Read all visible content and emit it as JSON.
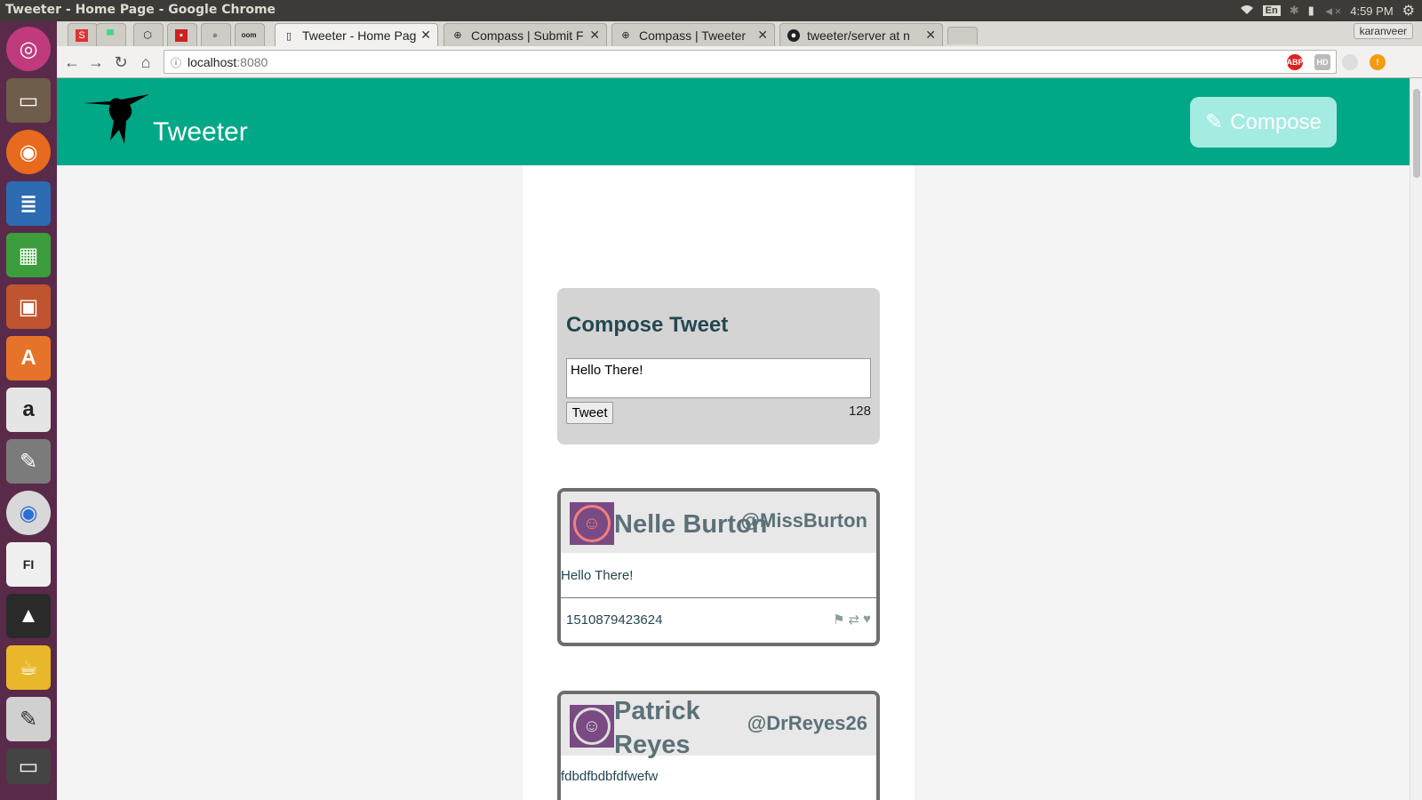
{
  "system": {
    "window_title": "Tweeter - Home Page - Google Chrome",
    "lang": "En",
    "time": "4:59 PM"
  },
  "browser": {
    "tabs": [
      {
        "label": "",
        "favicon": "S"
      },
      {
        "label": "",
        "favicon": "android-icon"
      },
      {
        "label": "",
        "favicon": "codepen-icon"
      },
      {
        "label": "",
        "favicon": "red-icon"
      },
      {
        "label": "",
        "favicon": "apple-icon"
      },
      {
        "label": "",
        "favicon": "oom"
      },
      {
        "label": "Tweeter - Home Pag",
        "favicon": "page-icon"
      },
      {
        "label": "Compass | Submit F",
        "favicon": "compass-icon"
      },
      {
        "label": "Compass | Tweeter",
        "favicon": "compass-icon"
      },
      {
        "label": "tweeter/server at n",
        "favicon": "github-icon"
      }
    ],
    "user": "karanveer",
    "url_host": "localhost",
    "url_port": ":8080"
  },
  "app": {
    "brand": "Tweeter",
    "compose_button": "Compose",
    "header_color": "#00a887"
  },
  "composer": {
    "title": "Compose Tweet",
    "text": "Hello There!",
    "tweet_button": "Tweet",
    "counter": "128"
  },
  "tweets": [
    {
      "name": "Nelle Burton",
      "handle": "@MissBurton",
      "content": "Hello There!",
      "timestamp": "1510879423624"
    },
    {
      "name": "Patrick Reyes",
      "handle": "@DrReyes26",
      "content": "fdbdfbdbfdfwefw",
      "timestamp": ""
    }
  ]
}
